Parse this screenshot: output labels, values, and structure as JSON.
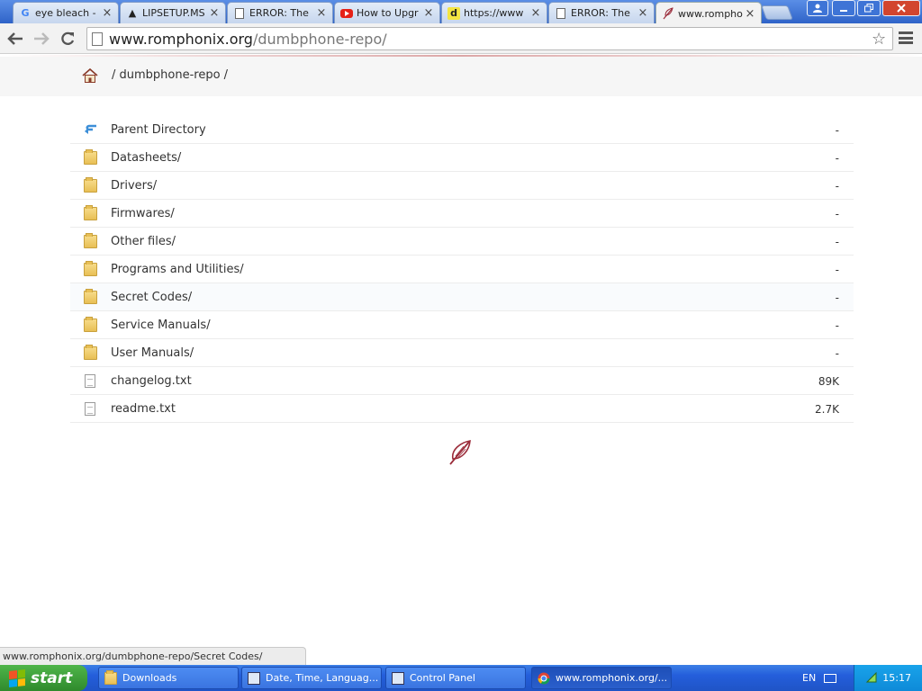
{
  "browser": {
    "tabs": [
      {
        "title": "eye bleach - ",
        "favicon": "google-g"
      },
      {
        "title": "LIPSETUP.MS",
        "favicon": "mountain"
      },
      {
        "title": "ERROR: The",
        "favicon": "page"
      },
      {
        "title": "How to Upgr",
        "favicon": "youtube"
      },
      {
        "title": "https://www",
        "favicon": "d-yellow"
      },
      {
        "title": "ERROR: The",
        "favicon": "page"
      },
      {
        "title": "www.rompho",
        "favicon": "feather"
      }
    ],
    "close_symbol": "×",
    "address": {
      "host": "www.romphonix.org",
      "path": "/dumbphone-repo/"
    }
  },
  "page": {
    "breadcrumb": "/ dumbphone-repo /",
    "entries": [
      {
        "name": "Parent Directory",
        "size": "-",
        "type": "parent"
      },
      {
        "name": "Datasheets/",
        "size": "-",
        "type": "folder"
      },
      {
        "name": "Drivers/",
        "size": "-",
        "type": "folder"
      },
      {
        "name": "Firmwares/",
        "size": "-",
        "type": "folder"
      },
      {
        "name": "Other files/",
        "size": "-",
        "type": "folder"
      },
      {
        "name": "Programs and Utilities/",
        "size": "-",
        "type": "folder"
      },
      {
        "name": "Secret Codes/",
        "size": "-",
        "type": "folder"
      },
      {
        "name": "Service Manuals/",
        "size": "-",
        "type": "folder"
      },
      {
        "name": "User Manuals/",
        "size": "-",
        "type": "folder"
      },
      {
        "name": "changelog.txt",
        "size": "89K",
        "type": "file"
      },
      {
        "name": "readme.txt",
        "size": "2.7K",
        "type": "file"
      }
    ]
  },
  "status_url": "www.romphonix.org/dumbphone-repo/Secret Codes/",
  "taskbar": {
    "start_label": "start",
    "items": [
      {
        "label": "Downloads",
        "icon": "folder-icon"
      },
      {
        "label": "Date, Time, Languag...",
        "icon": "control-panel-icon"
      },
      {
        "label": "Control Panel",
        "icon": "control-panel-icon"
      },
      {
        "label": "www.romphonix.org/...",
        "icon": "chrome-icon"
      }
    ],
    "language": "EN",
    "clock": "15:17"
  },
  "colors": {
    "accent": "#c56b6b",
    "taskbar": "#245edb",
    "start": "#2f8a2c"
  }
}
